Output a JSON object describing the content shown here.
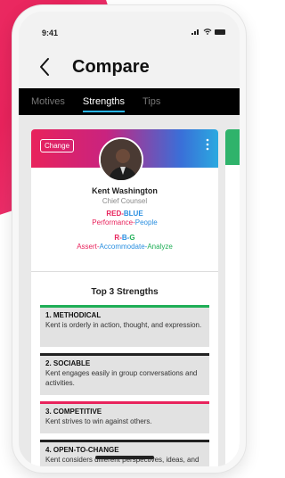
{
  "status": {
    "time": "9:41"
  },
  "header": {
    "title": "Compare"
  },
  "tabs": [
    {
      "label": "Motives"
    },
    {
      "label": "Strengths"
    },
    {
      "label": "Tips"
    }
  ],
  "profile": {
    "change_label": "Change",
    "name": "Kent Washington",
    "role": "Chief Counsel",
    "code1_red": "RED",
    "code1_dash": "-",
    "code1_blue": "BLUE",
    "sub1_red": "Performance",
    "sub1_dash": "-",
    "sub1_blue": "People",
    "code2_r": "R",
    "code2_b": "B",
    "code2_g": "G",
    "code2_dash": "-",
    "sub2_red": "Assert",
    "sub2_blue": "Accommodate",
    "sub2_green": "Analyze"
  },
  "strengths": {
    "title": "Top 3 Strengths",
    "items": [
      {
        "title": "1. METHODICAL",
        "desc": "Kent is orderly in action, thought, and expression."
      },
      {
        "title": "2. SOCIABLE",
        "desc": "Kent engages easily in group conversations and activities."
      },
      {
        "title": "3. COMPETITIVE",
        "desc": "Kent strives to win against others."
      },
      {
        "title": "4. OPEN-TO-CHANGE",
        "desc": "Kent considers different perspectives, ideas, and opinions."
      }
    ]
  },
  "colors": {
    "accent_red": "#e8235c",
    "accent_blue": "#2a8fe0",
    "accent_green": "#1fae56",
    "tab_underline": "#29b6f6"
  }
}
